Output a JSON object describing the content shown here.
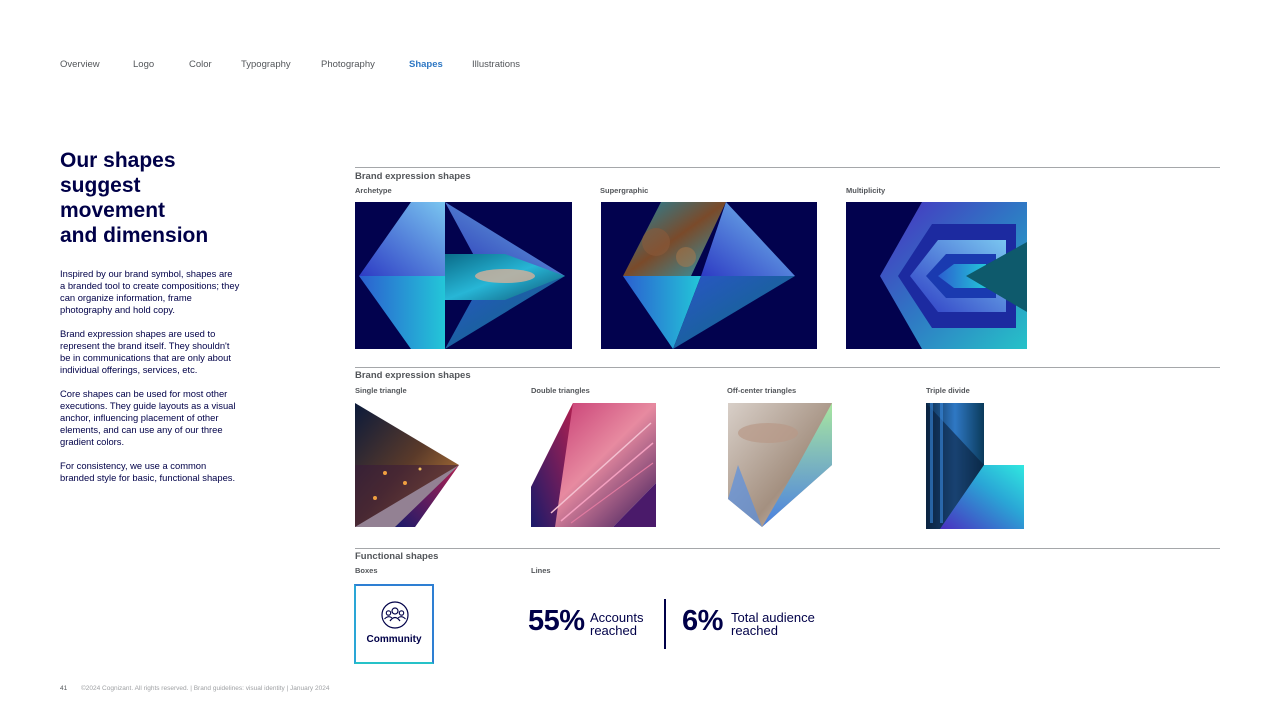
{
  "nav": {
    "items": [
      "Overview",
      "Logo",
      "Color",
      "Typography",
      "Photography",
      "Shapes",
      "Illustrations"
    ],
    "active": "Shapes"
  },
  "headline": [
    "Our shapes",
    "suggest",
    "movement",
    "and dimension"
  ],
  "intro": [
    "Inspired by our brand symbol, shapes are a branded tool to create compositions; they can organize information, frame photography and hold copy.",
    "Brand expression shapes are used to represent the brand itself. They shouldn't be in communications that are only about individual offerings, services, etc.",
    "Core shapes can be used for most other executions. They guide layouts as a visual anchor, influencing placement of other elements, and can use any of our three gradient colors.",
    "For consistency, we use a common branded style for basic, functional shapes."
  ],
  "section1": {
    "title": "Brand expression shapes",
    "labels": [
      "Archetype",
      "Supergraphic",
      "Multiplicity"
    ]
  },
  "section2": {
    "title": "Brand expression shapes",
    "labels": [
      "Single triangle",
      "Double triangles",
      "Off-center triangles",
      "Triple divide"
    ]
  },
  "section3": {
    "title": "Functional shapes",
    "labels": [
      "Boxes",
      "Lines"
    ],
    "box_label": "Community",
    "box_icon": "community-icon",
    "stats": [
      {
        "value": "55%",
        "label_line1": "Accounts",
        "label_line2": "reached"
      },
      {
        "value": "6%",
        "label_line1": "Total audience",
        "label_line2": "reached"
      }
    ]
  },
  "footer": {
    "page": "41",
    "text": "©2024 Cognizant. All rights reserved.  |  Brand guidelines: visual identity  |  January 2024"
  },
  "colors": {
    "navy": "#000048",
    "accent_blue": "#2f78c4",
    "teal": "#26c2c8",
    "rule": "#a5a7aa"
  }
}
